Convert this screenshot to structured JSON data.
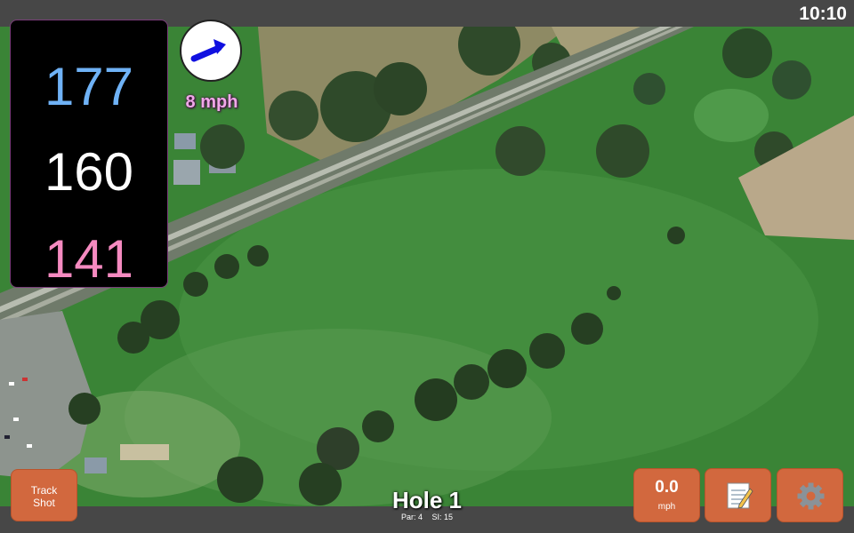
{
  "status_bar": {
    "time": "10:10"
  },
  "yardages": {
    "back": "177",
    "middle": "160",
    "front": "141"
  },
  "wind": {
    "speed_label": "8 mph",
    "direction_icon": "arrow-right-up-icon",
    "arrow_color": "#1010e0"
  },
  "buttons": {
    "track_shot_line1": "Track",
    "track_shot_line2": "Shot",
    "speed_value": "0.0",
    "speed_unit": "mph",
    "notes_icon": "notepad-icon",
    "settings_icon": "gear-icon"
  },
  "hole": {
    "title": "Hole 1",
    "par": "Par: 4",
    "si": "SI: 15"
  },
  "colors": {
    "accent": "#d2683e",
    "back_yardage": "#6fb2f6",
    "front_yardage": "#f58ac0",
    "wind_label": "#f0a8e8"
  }
}
